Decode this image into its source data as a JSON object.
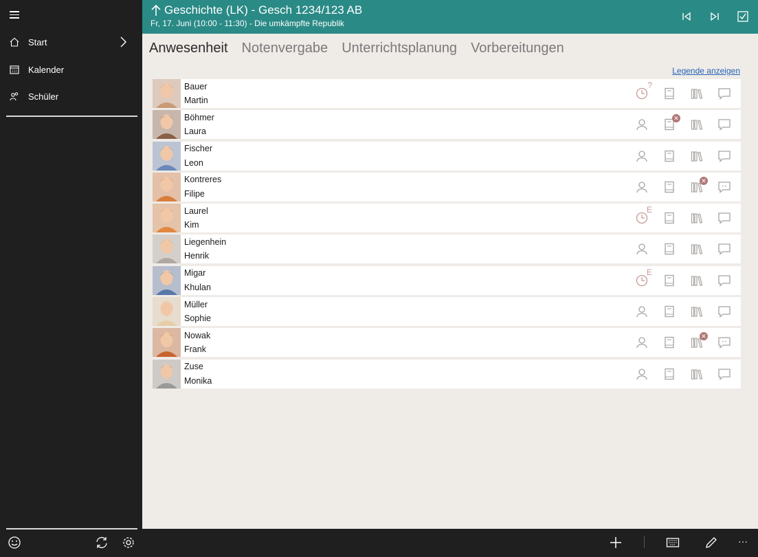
{
  "header": {
    "title": "Geschichte (LK) - Gesch 1234/123 AB",
    "subtitle": "Fr, 17. Juni (10:00 - 11:30) - Die umkämpfte Republik"
  },
  "sidebar": {
    "items": [
      {
        "label": "Start",
        "icon": "home-icon"
      },
      {
        "label": "Kalender",
        "icon": "calendar-icon"
      },
      {
        "label": "Schüler",
        "icon": "students-icon"
      }
    ]
  },
  "tabs": [
    "Anwesenheit",
    "Notenvergabe",
    "Unterrichtsplanung",
    "Vorbereitungen"
  ],
  "active_tab": "Anwesenheit",
  "legend_link": "Legende anzeigen",
  "students": [
    {
      "last": "Bauer",
      "first": "Martin",
      "presence": "clock",
      "presence_mark": "?",
      "book_badge": false,
      "library_badge": false,
      "comment": false,
      "avatar_color": "#c99a78"
    },
    {
      "last": "Böhmer",
      "first": "Laura",
      "presence": "person",
      "presence_mark": "",
      "book_badge": true,
      "library_badge": false,
      "comment": false,
      "avatar_color": "#8a6048"
    },
    {
      "last": "Fischer",
      "first": "Leon",
      "presence": "person",
      "presence_mark": "",
      "book_badge": false,
      "library_badge": false,
      "comment": false,
      "avatar_color": "#6a88b8"
    },
    {
      "last": "Kontreres",
      "first": "Filipe",
      "presence": "person",
      "presence_mark": "",
      "book_badge": false,
      "library_badge": true,
      "comment": true,
      "avatar_color": "#d97d3c"
    },
    {
      "last": "Laurel",
      "first": "Kim",
      "presence": "clock",
      "presence_mark": "E",
      "book_badge": false,
      "library_badge": false,
      "comment": false,
      "avatar_color": "#e08840"
    },
    {
      "last": "Liegenhein",
      "first": "Henrik",
      "presence": "person",
      "presence_mark": "",
      "book_badge": false,
      "library_badge": false,
      "comment": false,
      "avatar_color": "#b0a8a0"
    },
    {
      "last": "Migar",
      "first": "Khulan",
      "presence": "clock",
      "presence_mark": "E",
      "book_badge": false,
      "library_badge": false,
      "comment": false,
      "avatar_color": "#5878a8"
    },
    {
      "last": "Müller",
      "first": "Sophie",
      "presence": "person",
      "presence_mark": "",
      "book_badge": false,
      "library_badge": false,
      "comment": false,
      "avatar_color": "#e6cfa8"
    },
    {
      "last": "Nowak",
      "first": "Frank",
      "presence": "person",
      "presence_mark": "",
      "book_badge": false,
      "library_badge": true,
      "comment": true,
      "avatar_color": "#c7642e"
    },
    {
      "last": "Zuse",
      "first": "Monika",
      "presence": "person",
      "presence_mark": "",
      "book_badge": false,
      "library_badge": false,
      "comment": false,
      "avatar_color": "#9a9a98"
    }
  ],
  "bottom_bar": {
    "icons": [
      "add-icon",
      "keyboard-icon",
      "edit-icon",
      "more-icon"
    ],
    "more_label": "···"
  },
  "colors": {
    "header_bg": "#2a8a86",
    "sidebar_bg": "#1f1f1f",
    "content_bg": "#efebe7",
    "icon_tint": "#a8a4a0",
    "badge": "#b07878"
  }
}
